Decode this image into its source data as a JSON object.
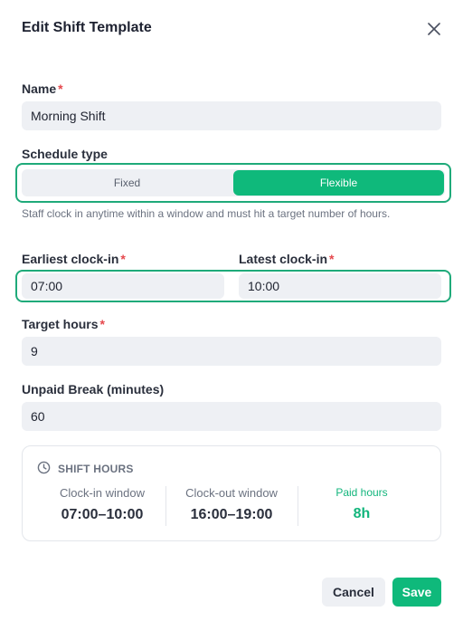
{
  "dialog": {
    "title": "Edit Shift Template",
    "close_icon": "close-icon"
  },
  "name": {
    "label": "Name",
    "required": "*",
    "value": "Morning Shift"
  },
  "schedule_type": {
    "label": "Schedule type",
    "options": [
      "Fixed",
      "Flexible"
    ],
    "selected": "Flexible",
    "hint": "Staff clock in anytime within a window and must hit a target number of hours."
  },
  "earliest_clock_in": {
    "label": "Earliest clock-in",
    "required": "*",
    "value": "07:00"
  },
  "latest_clock_in": {
    "label": "Latest clock-in",
    "required": "*",
    "value": "10:00"
  },
  "target_hours": {
    "label": "Target hours",
    "required": "*",
    "value": "9"
  },
  "unpaid_break": {
    "label": "Unpaid Break (minutes)",
    "value": "60"
  },
  "summary": {
    "heading": "SHIFT HOURS",
    "icon": "clock-icon",
    "clock_in_label": "Clock-in window",
    "clock_in_value": "07:00–10:00",
    "clock_out_label": "Clock-out window",
    "clock_out_value": "16:00–19:00",
    "paid_label": "Paid hours",
    "paid_value": "8h"
  },
  "actions": {
    "cancel_label": "Cancel",
    "save_label": "Save"
  },
  "colors": {
    "accent": "#0fb97b",
    "required": "#e5484d",
    "focus_border": "#1faa7a"
  }
}
